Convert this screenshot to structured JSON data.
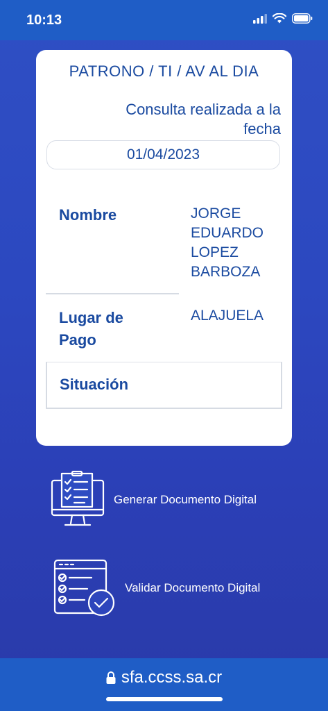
{
  "status_bar": {
    "time": "10:13"
  },
  "card": {
    "title": "PATRONO / TI / AV AL DIA",
    "consulta_text": "Consulta realizada a la fecha",
    "date": "01/04/2023",
    "nombre_label": "Nombre",
    "nombre_lines": [
      "JORGE",
      "EDUARDO",
      "LOPEZ",
      "BARBOZA"
    ],
    "lugar_label_line1": "Lugar de",
    "lugar_label_line2": "Pago",
    "lugar_value": "ALAJUELA",
    "situacion_label": "Situación"
  },
  "actions": [
    {
      "label": "Generar Documento Digital",
      "icon": "computer-checklist-icon"
    },
    {
      "label": "Validar Documento Digital",
      "icon": "document-check-icon"
    }
  ],
  "browser": {
    "url": "sfa.ccss.sa.cr"
  },
  "colors": {
    "accent": "#1a4aa0",
    "bar": "#1f5dc6"
  }
}
